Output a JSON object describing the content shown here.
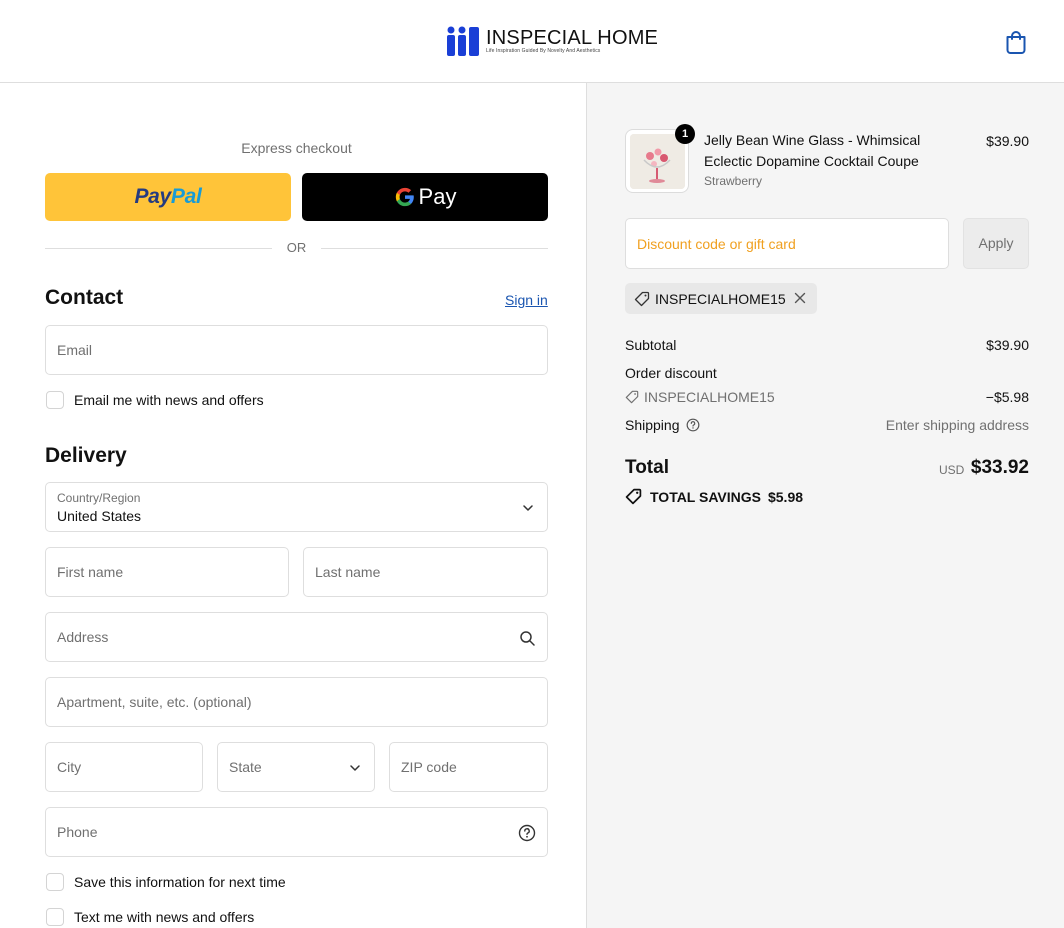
{
  "header": {
    "brand_name": "INSPECIAL HOME",
    "brand_tagline": "Life Inspiration Guided By Novelty And Aesthetics",
    "brand_color": "#1a3fd6",
    "cart_icon": "shopping-bag-icon"
  },
  "express": {
    "title": "Express checkout",
    "paypal_part1": "Pay",
    "paypal_part2": "Pal",
    "gpay_label": "Pay",
    "divider": "OR"
  },
  "contact": {
    "heading": "Contact",
    "signin": "Sign in",
    "email_placeholder": "Email",
    "newsletter_label": "Email me with news and offers"
  },
  "delivery": {
    "heading": "Delivery",
    "country_label": "Country/Region",
    "country_value": "United States",
    "first_name": "First name",
    "last_name": "Last name",
    "address": "Address",
    "apartment": "Apartment, suite, etc. (optional)",
    "city": "City",
    "state": "State",
    "zip": "ZIP code",
    "phone": "Phone",
    "save_info_label": "Save this information for next time",
    "text_offers_label": "Text me with news and offers"
  },
  "summary": {
    "item": {
      "quantity": "1",
      "title": "Jelly Bean Wine Glass - Whimsical Eclectic Dopamine Cocktail Coupe",
      "variant": "Strawberry",
      "price": "$39.90"
    },
    "discount_placeholder": "Discount code or gift card",
    "apply_label": "Apply",
    "applied_code": "INSPECIALHOME15",
    "subtotal_label": "Subtotal",
    "subtotal_value": "$39.90",
    "order_discount_label": "Order discount",
    "order_discount_code": "INSPECIALHOME15",
    "order_discount_value": "−$5.98",
    "shipping_label": "Shipping",
    "shipping_value": "Enter shipping address",
    "total_label": "Total",
    "total_currency": "USD",
    "total_value": "$33.92",
    "savings_label": "TOTAL SAVINGS",
    "savings_value": "$5.98"
  }
}
